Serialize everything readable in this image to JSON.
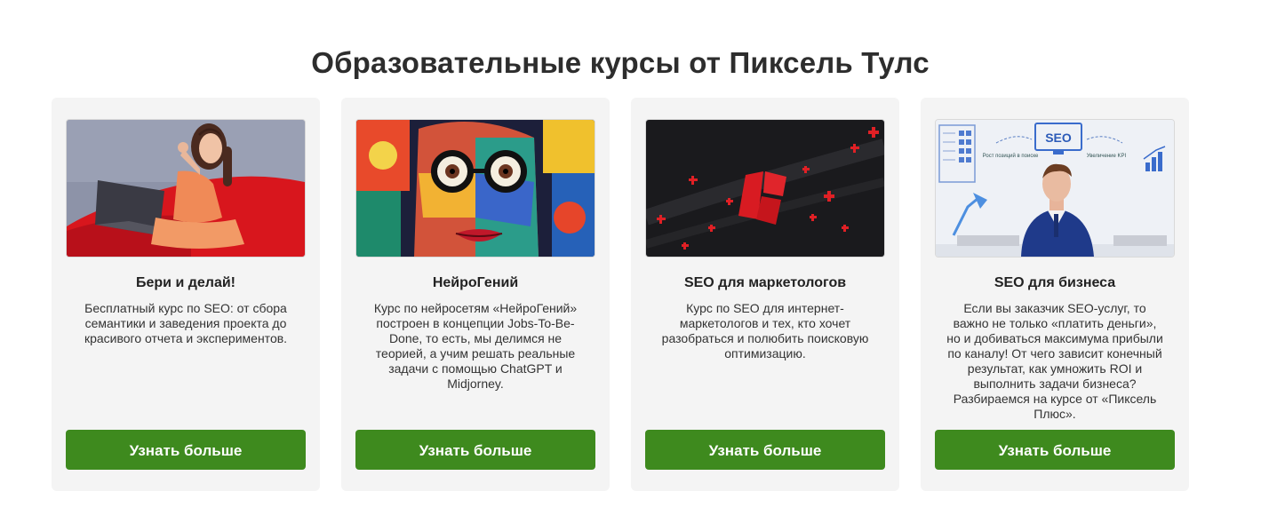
{
  "page": {
    "title": "Образовательные курсы от Пиксель Тулс"
  },
  "colors": {
    "button_bg": "#3e8a1e",
    "card_bg": "#f4f4f4",
    "title": "#2d2d2d"
  },
  "cards": [
    {
      "title": "Бери и делай!",
      "description": "Бесплатный курс по SEO: от сбора семантики и заведения проекта до красивого отчета и экспериментов.",
      "button": "Узнать больше",
      "image": "woman-with-laptop-thumbs-up"
    },
    {
      "title": "НейроГений",
      "description": "Курс по нейросетям «НейроГений» построен в концепции Jobs-To-Be-Done, то есть, мы делимся не теорией, а учим решать реальные задачи с помощью ChatGPT и Midjorney.",
      "button": "Узнать больше",
      "image": "colorful-ai-portrait-with-glasses"
    },
    {
      "title": "SEO для маркетологов",
      "description": "Курс по SEO для интернет-маркетологов и тех, кто хочет разобраться и полюбить поисковую оптимизацию.",
      "button": "Узнать больше",
      "image": "red-logo-on-dark-background"
    },
    {
      "title": "SEO для бизнеса",
      "description": "Если вы заказчик SEO-услуг, то важно не только «платить деньги», но и добиваться максимума прибыли по каналу! От чего зависит конечный результат, как умножить ROI и выполнить задачи бизнеса? Разбираемся на курсе от «Пиксель Плюс».",
      "button": "Узнать больше",
      "image": "presenter-with-seo-diagram",
      "image_text": {
        "seo": "SEO",
        "left_caption": "Рост позиций в поиске",
        "right_caption": "Увеличение KPI"
      }
    }
  ]
}
